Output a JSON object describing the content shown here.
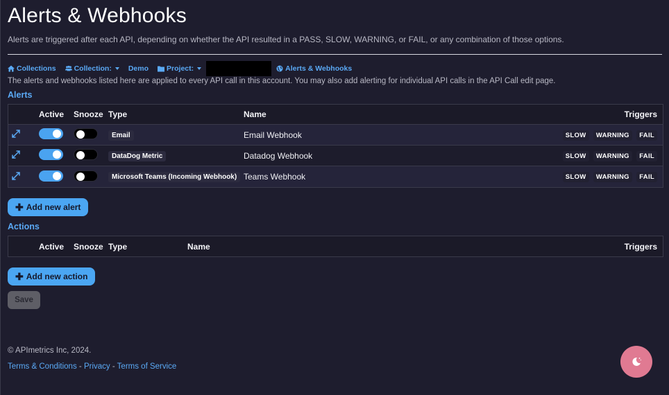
{
  "header": {
    "title": "Alerts & Webhooks",
    "subtitle": "Alerts are triggered after each API, depending on whether the API resulted in a PASS, SLOW, WARNING, or FAIL, or any combination of those options."
  },
  "breadcrumb": {
    "collections": "Collections",
    "collection_label": "Collection:",
    "collection_value": "Demo",
    "project_label": "Project:",
    "current": "Alerts & Webhooks"
  },
  "info_text": "The alerts and webhooks listed here are applied to every API call in this account. You may also add alerting for individual API calls in the API Call edit page.",
  "alerts": {
    "section_title": "Alerts",
    "columns": {
      "active": "Active",
      "snooze": "Snooze",
      "type": "Type",
      "name": "Name",
      "triggers": "Triggers"
    },
    "rows": [
      {
        "type": "Email",
        "name": "Email Webhook",
        "active": true,
        "snooze": false,
        "triggers": [
          "SLOW",
          "WARNING",
          "FAIL"
        ]
      },
      {
        "type": "DataDog Metric",
        "name": "Datadog Webhook",
        "active": true,
        "snooze": false,
        "triggers": [
          "SLOW",
          "WARNING",
          "FAIL"
        ]
      },
      {
        "type": "Microsoft Teams (Incoming Webhook)",
        "name": "Teams Webhook",
        "active": true,
        "snooze": false,
        "triggers": [
          "SLOW",
          "WARNING",
          "FAIL"
        ]
      }
    ],
    "add_button": "Add new alert"
  },
  "actions": {
    "section_title": "Actions",
    "columns": {
      "active": "Active",
      "snooze": "Snooze",
      "type": "Type",
      "name": "Name",
      "triggers": "Triggers"
    },
    "add_button": "Add new action"
  },
  "save_button": "Save",
  "footer": {
    "copyright": "© APImetrics Inc, 2024.",
    "terms": "Terms & Conditions",
    "sep1": " - ",
    "privacy": "Privacy",
    "sep2": " - ",
    "tos": "Terms of Service"
  },
  "colors": {
    "background": "#1e1d2e",
    "accent": "#4ba6f2",
    "link": "#5aa9f5",
    "fab": "#e07a92"
  },
  "icons": {
    "breadcrumb_collections": "home-icon",
    "breadcrumb_collection": "users-icon",
    "breadcrumb_project": "folder-icon",
    "breadcrumb_current": "globe-icon",
    "row_expand": "expand-icon",
    "add": "plus-icon",
    "fab": "moon-icon"
  }
}
